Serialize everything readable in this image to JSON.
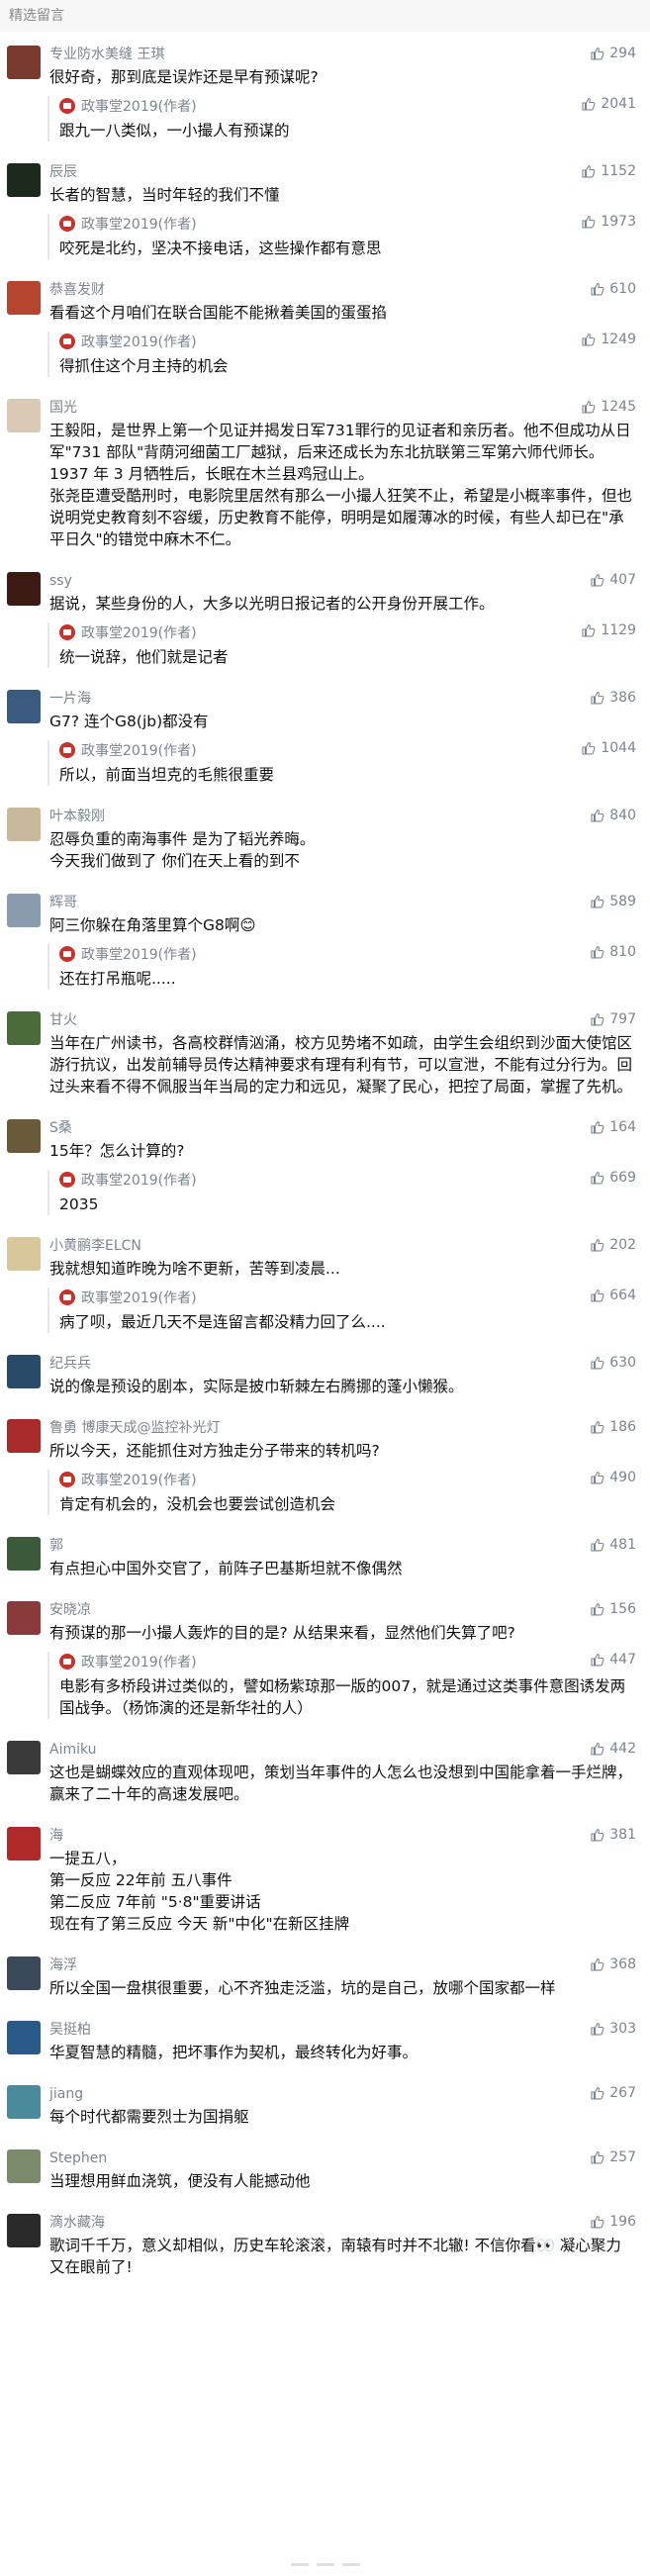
{
  "header": {
    "title": "精选留言"
  },
  "comments": [
    {
      "user": "专业防水美缝 王琪",
      "content": "很好奇，那到底是误炸还是早有预谋呢?",
      "likes": "294",
      "reply": {
        "user": "政事堂2019(作者)",
        "content": "跟九一八类似，一小撮人有预谋的",
        "likes": "2041"
      },
      "avatar": "#7a3a2e"
    },
    {
      "user": "辰辰",
      "content": "长者的智慧，当时年轻的我们不懂",
      "likes": "1152",
      "reply": {
        "user": "政事堂2019(作者)",
        "content": "咬死是北约，坚决不接电话，这些操作都有意思",
        "likes": "1973"
      },
      "avatar": "#1b2a1d"
    },
    {
      "user": "恭喜发财",
      "content": "看看这个月咱们在联合国能不能揪着美国的蛋蛋掐",
      "likes": "610",
      "reply": {
        "user": "政事堂2019(作者)",
        "content": "得抓住这个月主持的机会",
        "likes": "1249"
      },
      "avatar": "#b5452f"
    },
    {
      "user": "国光",
      "content": "王毅阳，是世界上第一个见证并揭发日军731罪行的见证者和亲历者。他不但成功从日军\"731 部队\"背荫河细菌工厂越狱，后来还成长为东北抗联第三军第六师代师长。1937 年 3 月牺牲后，长眠在木兰县鸡冠山上。\n张尧臣遭受酷刑时，电影院里居然有那么一小撮人狂笑不止，希望是小概率事件，但也说明党史教育刻不容缓，历史教育不能停，明明是如履薄冰的时候，有些人却已在\"承平日久\"的错觉中麻木不仁。",
      "likes": "1245",
      "reply": null,
      "avatar": "#d9c9b5"
    },
    {
      "user": "ssy",
      "content": "据说，某些身份的人，大多以光明日报记者的公开身份开展工作。",
      "likes": "407",
      "reply": {
        "user": "政事堂2019(作者)",
        "content": "统一说辞，他们就是记者",
        "likes": "1129"
      },
      "avatar": "#3a1a12"
    },
    {
      "user": "一片海",
      "content": "G7? 连个G8(jb)都没有",
      "likes": "386",
      "reply": {
        "user": "政事堂2019(作者)",
        "content": "所以，前面当坦克的毛熊很重要",
        "likes": "1044"
      },
      "avatar": "#3a5a80"
    },
    {
      "user": "叶本毅刚",
      "content": "忍辱负重的南海事件 是为了韬光养晦。\n今天我们做到了 你们在天上看的到不",
      "likes": "840",
      "reply": null,
      "avatar": "#c9b89a"
    },
    {
      "user": "辉哥",
      "content": "阿三你躲在角落里算个G8啊😊",
      "likes": "589",
      "reply": {
        "user": "政事堂2019(作者)",
        "content": "还在打吊瓶呢.....",
        "likes": "810"
      },
      "avatar": "#8a9bb0"
    },
    {
      "user": "甘火",
      "content": "当年在广州读书，各高校群情汹涌，校方见势堵不如疏，由学生会组织到沙面大使馆区游行抗议，出发前辅导员传达精神要求有理有利有节，可以宣泄，不能有过分行为。回过头来看不得不佩服当年当局的定力和远见，凝聚了民心，把控了局面，掌握了先机。",
      "likes": "797",
      "reply": null,
      "avatar": "#4a6b3a"
    },
    {
      "user": "S桑",
      "content": "15年？怎么计算的?",
      "likes": "164",
      "reply": {
        "user": "政事堂2019(作者)",
        "content": "2035",
        "likes": "669"
      },
      "avatar": "#6b5a3a"
    },
    {
      "user": "小黄鹂李ELCN",
      "content": "我就想知道昨晚为啥不更新，苦等到凌晨...",
      "likes": "202",
      "reply": {
        "user": "政事堂2019(作者)",
        "content": "病了呗，最近几天不是连留言都没精力回了么....",
        "likes": "664"
      },
      "avatar": "#d8c79a"
    },
    {
      "user": "纪兵兵",
      "content": "说的像是预设的剧本，实际是披巾斩棘左右腾挪的蓬小懒猴。",
      "likes": "630",
      "reply": null,
      "avatar": "#2a4a6a"
    },
    {
      "user": "鲁勇 博康天成@监控补光灯",
      "content": "所以今天，还能抓住对方独走分子带来的转机吗?",
      "likes": "186",
      "reply": {
        "user": "政事堂2019(作者)",
        "content": "肯定有机会的，没机会也要尝试创造机会",
        "likes": "490"
      },
      "avatar": "#a82a2a"
    },
    {
      "user": "郭",
      "content": "有点担心中国外交官了，前阵子巴基斯坦就不像偶然",
      "likes": "481",
      "reply": null,
      "avatar": "#3a5a3a"
    },
    {
      "user": "安晓凉",
      "content": "有预谋的那一小撮人轰炸的目的是? 从结果来看，显然他们失算了吧?",
      "likes": "156",
      "reply": {
        "user": "政事堂2019(作者)",
        "content": "电影有多桥段讲过类似的，譬如杨紫琼那一版的007，就是通过这类事件意图诱发两国战争。（杨饰演的还是新华社的人）",
        "likes": "447"
      },
      "avatar": "#8a3a3a"
    },
    {
      "user": "Aimiku",
      "content": "这也是蝴蝶效应的直观体现吧，策划当年事件的人怎么也没想到中国能拿着一手烂牌，赢来了二十年的高速发展吧。",
      "likes": "442",
      "reply": null,
      "avatar": "#3a3a3a"
    },
    {
      "user": "海",
      "content": "一提五八，\n第一反应 22年前 五八事件\n第二反应 7年前 \"5·8\"重要讲话\n现在有了第三反应 今天 新\"中化\"在新区挂牌",
      "likes": "381",
      "reply": null,
      "avatar": "#b02a2a"
    },
    {
      "user": "海浮",
      "content": "所以全国一盘棋很重要，心不齐独走泛滥，坑的是自己，放哪个国家都一样",
      "likes": "368",
      "reply": null,
      "avatar": "#3a4a5a"
    },
    {
      "user": "吴挺柏",
      "content": "华夏智慧的精髓，把坏事作为契机，最终转化为好事。",
      "likes": "303",
      "reply": null,
      "avatar": "#2a5a8a"
    },
    {
      "user": "jiang",
      "content": "每个时代都需要烈士为国捐躯",
      "likes": "267",
      "reply": null,
      "avatar": "#4a8a9a"
    },
    {
      "user": "Stephen",
      "content": "当理想用鲜血浇筑，便没有人能撼动他",
      "likes": "257",
      "reply": null,
      "avatar": "#7a8a6a"
    },
    {
      "user": "滴水藏海",
      "content": "歌词千千万，意义却相似，历史车轮滚滚，南辕有时并不北辙! 不信你看👀 凝心聚力又在眼前了!",
      "likes": "196",
      "reply": null,
      "avatar": "#2a2a2a"
    }
  ]
}
